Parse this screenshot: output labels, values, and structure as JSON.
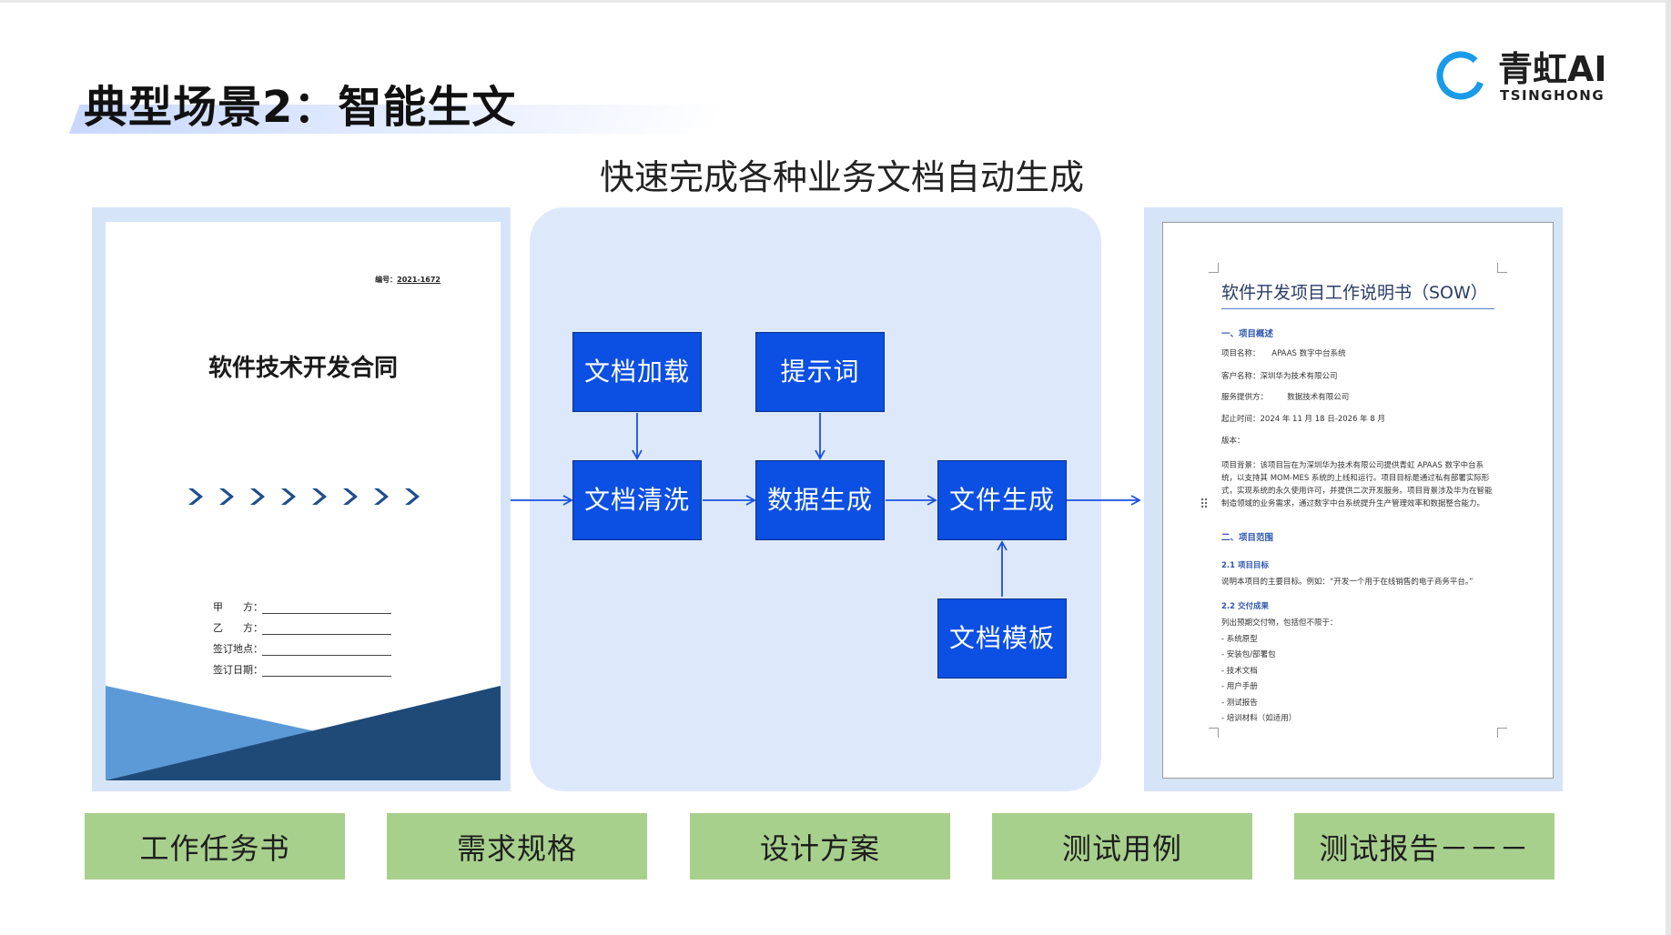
{
  "header": {
    "title": "典型场景2：智能生文",
    "subtitle": "快速完成各种业务文档自动生成"
  },
  "logo": {
    "main": "青虹AI",
    "sub": "TSINGHONG"
  },
  "left_doc": {
    "number_label": "编号：",
    "number_value": "2021-1672",
    "title": "软件技术开发合同",
    "fields": [
      "甲　　方：",
      "乙　　方：",
      "签订地点：",
      "签订日期："
    ]
  },
  "flow": {
    "nodes": {
      "load": "文档加载",
      "prompt": "提示词",
      "clean": "文档清洗",
      "data": "数据生成",
      "file": "文件生成",
      "template": "文档模板"
    }
  },
  "right_doc": {
    "title": "软件开发项目工作说明书（SOW）",
    "s1_heading": "一、项目概述",
    "project_name": "项目名称：　　APAAS 数字中台系统",
    "client_name": "客户名称：深圳华为技术有限公司",
    "provider": "服务提供方：　　　数据技术有限公司",
    "period": "起止时间：2024 年 11 月 18 日-2026 年 8 月",
    "version": "版本：",
    "background": "项目背景：该项目旨在为深圳华为技术有限公司提供青虹 APAAS 数字中台系统，以支持其 MOM-MES 系统的上线和运行。项目目标是通过私有部署实际形式，实现系统的永久使用许可，并提供二次开发服务。项目背景涉及华为在智能制造领域的业务需求，通过数字中台系统提升生产管理效率和数据整合能力。",
    "s2_heading": "二、项目范围",
    "s21_heading": "2.1 项目目标",
    "s21_text": "说明本项目的主要目标。例如：“开发一个用于在线销售的电子商务平台。”",
    "s22_heading": "2.2 交付成果",
    "s22_intro": "列出预期交付物，包括但不限于：",
    "deliverables": [
      "- 系统原型",
      "- 安装包/部署包",
      "- 技术文档",
      "- 用户手册",
      "- 测试报告",
      "- 培训材料（如适用）"
    ]
  },
  "tags": [
    "工作任务书",
    "需求规格",
    "设计方案",
    "测试用例",
    "测试报告－－－"
  ],
  "colors": {
    "node_fill": "#0b4fe3",
    "panel_bg": "#dde9fb",
    "tag_bg": "#a8d08d",
    "arrow": "#1a50e0",
    "logo_ring": "#1a9be8"
  }
}
